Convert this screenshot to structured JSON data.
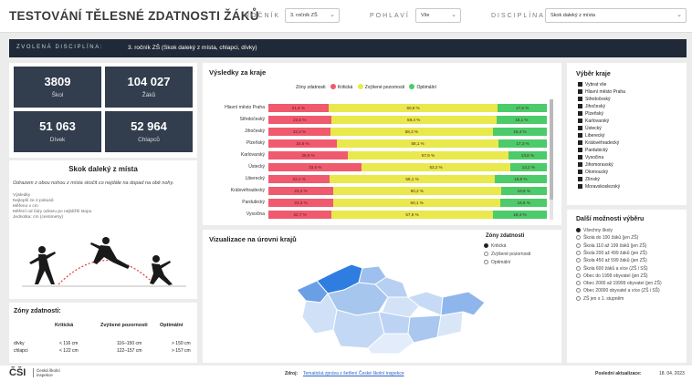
{
  "header": {
    "title": "TESTOVÁNÍ TĚLESNÉ ZDATNOSTI ŽÁKŮ",
    "filters": [
      {
        "label": "ROČNÍK",
        "value": "3. ročník ZŠ"
      },
      {
        "label": "POHLAVÍ",
        "value": "Vše"
      },
      {
        "label": "DISCIPLÍNA",
        "value": "Skok daleký z místa"
      }
    ]
  },
  "band": {
    "label": "ZVOLENÁ DISCIPLÍNA:",
    "value": "3. ročník ZŠ (Skok daleký z místa, chlapci, dívky)"
  },
  "kpis": [
    {
      "n": "3809",
      "t": "Škol"
    },
    {
      "n": "104 027",
      "t": "Žáků"
    },
    {
      "n": "51 063",
      "t": "Dívek"
    },
    {
      "n": "52 964",
      "t": "Chlapců"
    }
  ],
  "discipline": {
    "title": "Skok daleký z místa",
    "desc": "Odrazem z obou nohou z místa skočit co nejdále na dopad na obě nohy.",
    "items": [
      "Výsledky",
      "Nejlepší ze 2 pokusů",
      "Měřeno v cm",
      "Měření od čáry odrazu po nejbližší stopu",
      "Jednotka: cm (centimetry)"
    ]
  },
  "zones": {
    "title": "Zóny zdatnosti:",
    "cols": [
      "Kritická",
      "Zvýšené pozornosti",
      "Optimální"
    ],
    "rows": [
      {
        "name": "dívky",
        "v": [
          "< 116 cm",
          "116–150 cm",
          "> 150 cm"
        ]
      },
      {
        "name": "chlapci",
        "v": [
          "< 122 cm",
          "122–157 cm",
          "> 157 cm"
        ]
      }
    ]
  },
  "results": {
    "title": "Výsledky za kraje",
    "legend_title": "Zóny zdatnosti",
    "legend": [
      {
        "name": "Kritická",
        "color": "#f05a6e"
      },
      {
        "name": "Zvýšené pozornosti",
        "color": "#e9e84c"
      },
      {
        "name": "Optimální",
        "color": "#4ccb6a"
      }
    ],
    "rows": [
      {
        "name": "Hlavní město Praha",
        "v": [
          21.6,
          60.8,
          17.6
        ]
      },
      {
        "name": "Středočeský",
        "v": [
          22.5,
          59.4,
          18.1
        ]
      },
      {
        "name": "Jihočeský",
        "v": [
          22.3,
          58.3,
          19.4
        ]
      },
      {
        "name": "Plzeňský",
        "v": [
          24.6,
          58.1,
          17.3
        ]
      },
      {
        "name": "Karlovarský",
        "v": [
          28.6,
          57.6,
          13.8
        ]
      },
      {
        "name": "Ústecký",
        "v": [
          33.6,
          53.2,
          13.2
        ]
      },
      {
        "name": "Liberecký",
        "v": [
          22.1,
          59.1,
          18.8
        ]
      },
      {
        "name": "Královéhradecký",
        "v": [
          23.3,
          60.2,
          16.5
        ]
      },
      {
        "name": "Pardubický",
        "v": [
          23.3,
          60.1,
          16.6
        ]
      },
      {
        "name": "Vysočina",
        "v": [
          22.7,
          57.9,
          19.4
        ]
      }
    ]
  },
  "map": {
    "title": "Vizualizace na úrovni krajů",
    "legend_title": "Zóny zdatnosti",
    "options": [
      "Kritická",
      "Zvýšené pozornosti",
      "Optimální"
    ],
    "selected": 0
  },
  "regions": {
    "title": "Výběr kraje",
    "items": [
      "Vybrat vše",
      "Hlavní město Praha",
      "Středočeský",
      "Jihočeský",
      "Plzeňský",
      "Karlovarský",
      "Ústecký",
      "Liberecký",
      "Královéhradecký",
      "Pardubický",
      "Vysočina",
      "Jihomoravský",
      "Olomoucký",
      "Zlínský",
      "Moravskoslezský"
    ]
  },
  "more": {
    "title": "Další možnosti výběru",
    "selected": 0,
    "items": [
      "Všechny školy",
      "Škola do 100 žáků (jen ZŠ)",
      "Škola 110 až 199 žáků (jen ZŠ)",
      "Škola 200 až 499 žáků (jen ZŠ)",
      "Škola 450 až 599 žáků (jen ZŠ)",
      "Škola 600 žáků a více (ZŠ i SŠ)",
      "Obec do 1999 obyvatel (jen ZŠ)",
      "Obec 2000 až 19999 obyvatel (jen ZŠ)",
      "Obec 20000 obyvatel a více (ZŠ i SŠ)",
      "ZŠ jen s 1. stupněm"
    ]
  },
  "footer": {
    "logo": "ČŠI",
    "logo_text": "Česká školní inspekce",
    "source_label": "Zdroj:",
    "source_link": "Tematická zpráva z šetření České školní inspekce",
    "update_label": "Poslední aktualizace:",
    "update_value": "18. 04. 2023"
  },
  "colors": {
    "critical": "#f05a6e",
    "attention": "#e9e84c",
    "optimal": "#4ccb6a",
    "kpi": "#323d4d",
    "band": "#1f2937"
  }
}
